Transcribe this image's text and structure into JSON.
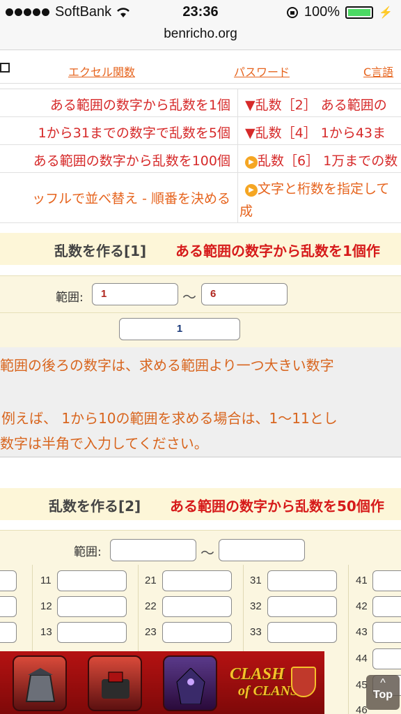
{
  "status": {
    "carrier": "SoftBank",
    "time": "23:36",
    "battery": "100%",
    "url": "benricho.org"
  },
  "nav": {
    "links": [
      "エクセル関数",
      "パスワード",
      "C言語"
    ]
  },
  "link_table": {
    "rows": [
      {
        "left": "ある範囲の数字から乱数を1個",
        "right_prefix": "▼乱数［2］",
        "right_text": "ある範囲の"
      },
      {
        "left": "1から31までの数字で乱数を5個",
        "right_prefix": "▼乱数［4］",
        "right_text": "1から43ま"
      },
      {
        "left": "ある範囲の数字から乱数を100個",
        "right_prefix": "乱数［6］",
        "right_text": "1万までの数"
      },
      {
        "left": "ッフルで並べ替え - 順番を決める",
        "right_prefix": "",
        "right_text": "文字と桁数を指定して",
        "right_line2": "成"
      }
    ]
  },
  "section1": {
    "title": "乱数を作る[1]",
    "subtitle": "ある範囲の数字から乱数を1個作",
    "range_label": "範囲:",
    "tilde": "〜",
    "min_value": "1",
    "max_value": "6",
    "result": "1"
  },
  "notes": {
    "line1": "範囲の後ろの数字は、求める範囲より一つ大きい数字",
    "line2": "例えば、 1から10の範囲を求める場合は、1〜11とし",
    "line3": "数字は半角で入力してください。"
  },
  "section2": {
    "title": "乱数を作る[2]",
    "subtitle": "ある範囲の数字から乱数を50個作",
    "range_label": "範囲:",
    "tilde": "〜",
    "min_value": "",
    "max_value": ""
  },
  "grid": {
    "col2": [
      "11",
      "12",
      "13"
    ],
    "col3": [
      "21",
      "22",
      "23"
    ],
    "col4": [
      "31",
      "32",
      "33"
    ],
    "col5": [
      "41",
      "42",
      "43",
      "44",
      "45",
      "46"
    ]
  },
  "ad": {
    "logo_line1": "CLASH",
    "logo_line2": "of CLANS"
  },
  "top_button": {
    "arrow": "^",
    "label": "Top"
  },
  "colors": {
    "accent_orange": "#e6641e",
    "accent_red": "#d61a1a",
    "panel_bg": "#fbf6e0"
  }
}
